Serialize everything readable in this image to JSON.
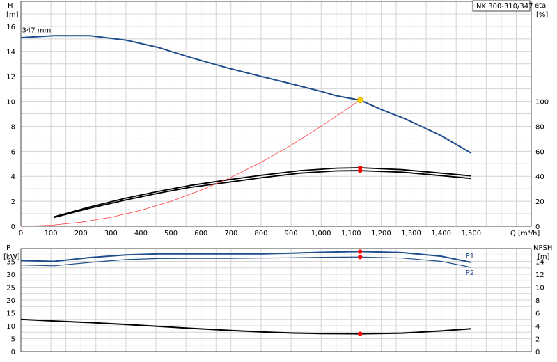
{
  "chart_data": [
    {
      "type": "line",
      "title": "NK 300-310/347",
      "ylabel_left": [
        "H",
        "[m]"
      ],
      "ylabel_right": [
        "eta",
        "[%]"
      ],
      "xlabel": "Q [m³/h]",
      "xlim": [
        0,
        1700
      ],
      "ylim_left": [
        0,
        18
      ],
      "ylim_right_range": [
        0,
        100
      ],
      "grid": true,
      "x_ticks": [
        0,
        100,
        200,
        300,
        400,
        500,
        600,
        700,
        800,
        900,
        1000,
        1100,
        1200,
        1300,
        1400,
        1500
      ],
      "x_tick_labels": [
        "0",
        "100",
        "200",
        "300",
        "400",
        "500",
        "600",
        "700",
        "800",
        "900",
        "1,000",
        "1,100",
        "1,200",
        "1,300",
        "1,400",
        "1,500"
      ],
      "y_left_ticks": [
        0,
        2,
        4,
        6,
        8,
        10,
        12,
        14,
        16
      ],
      "y_right_ticks": [
        0,
        20,
        40,
        60,
        80,
        100
      ],
      "annotations": [
        {
          "text": "347 mm",
          "x": 80,
          "y": 15.3
        }
      ],
      "series": [
        {
          "role": "head",
          "color": "#1f4e8c",
          "axis": "left",
          "x": [
            0,
            110,
            230,
            350,
            460,
            560,
            700,
            800,
            900,
            1000,
            1050,
            1130,
            1200,
            1280,
            1400,
            1500
          ],
          "y": [
            15.1,
            15.25,
            15.25,
            14.9,
            14.3,
            13.55,
            12.6,
            12.0,
            11.4,
            10.8,
            10.45,
            10.1,
            9.35,
            8.6,
            7.25,
            5.85
          ]
        },
        {
          "role": "efficiency-upper",
          "color": "#000000",
          "axis": "right",
          "x": [
            110,
            230,
            350,
            460,
            560,
            700,
            800,
            930,
            1050,
            1130,
            1270,
            1400,
            1500
          ],
          "y": [
            7.5,
            15.5,
            22.5,
            28.0,
            32.5,
            37.5,
            40.8,
            44.5,
            46.5,
            46.8,
            45.3,
            42.5,
            40.3
          ]
        },
        {
          "role": "efficiency-lower",
          "color": "#000000",
          "axis": "right",
          "x": [
            110,
            230,
            350,
            460,
            560,
            700,
            800,
            930,
            1050,
            1130,
            1270,
            1400,
            1500
          ],
          "y": [
            7.0,
            14.5,
            21.0,
            26.5,
            31.0,
            35.5,
            38.8,
            42.5,
            44.3,
            44.5,
            43.3,
            40.5,
            38.3
          ]
        },
        {
          "role": "system-curve",
          "color": "#ff3a3a",
          "axis": "left",
          "x": [
            0,
            100,
            200,
            300,
            400,
            500,
            600,
            700,
            800,
            900,
            1000,
            1130
          ],
          "y": [
            0,
            0.08,
            0.32,
            0.72,
            1.28,
            2.0,
            2.88,
            3.92,
            5.12,
            6.48,
            8.0,
            10.1
          ]
        }
      ],
      "operating_points": [
        {
          "series": "head",
          "x": 1130,
          "y": 10.1,
          "color": "#ffd000"
        },
        {
          "series": "efficiency-upper",
          "x": 1130,
          "y": 46.8,
          "color": "#ff0000"
        },
        {
          "series": "efficiency-lower",
          "x": 1130,
          "y": 44.5,
          "color": "#ff0000"
        }
      ]
    },
    {
      "type": "line",
      "ylabel_left": [
        "P",
        "[kW]"
      ],
      "ylabel_right": [
        "NPSH",
        "[m]"
      ],
      "xlim": [
        0,
        1700
      ],
      "ylim_left": [
        0,
        40
      ],
      "ylim_right": [
        0,
        16
      ],
      "grid": true,
      "y_left_ticks": [
        0,
        5,
        10,
        15,
        20,
        25,
        30,
        35
      ],
      "y_right_ticks": [
        0,
        2,
        4,
        6,
        8,
        10,
        12,
        14
      ],
      "series": [
        {
          "name": "P1",
          "color": "#1f4e8c",
          "axis": "left",
          "x": [
            0,
            110,
            230,
            350,
            460,
            560,
            700,
            800,
            900,
            1000,
            1130,
            1270,
            1400,
            1500
          ],
          "y": [
            35.3,
            35.0,
            36.5,
            37.5,
            37.9,
            37.9,
            37.9,
            37.9,
            38.2,
            38.5,
            38.8,
            38.4,
            37.0,
            34.6
          ]
        },
        {
          "name": "P2",
          "color": "#1f4e8c",
          "axis": "left",
          "x": [
            0,
            110,
            230,
            350,
            460,
            560,
            700,
            800,
            900,
            1000,
            1130,
            1270,
            1400,
            1500
          ],
          "y": [
            33.6,
            33.3,
            34.6,
            35.7,
            36.1,
            36.2,
            36.2,
            36.3,
            36.4,
            36.6,
            36.7,
            36.3,
            35.0,
            32.7
          ]
        },
        {
          "role": "npsh",
          "color": "#000000",
          "axis": "right",
          "x": [
            0,
            110,
            230,
            350,
            460,
            560,
            700,
            800,
            900,
            1000,
            1130,
            1270,
            1400,
            1500
          ],
          "y": [
            5.0,
            4.75,
            4.5,
            4.2,
            3.9,
            3.62,
            3.28,
            3.05,
            2.88,
            2.78,
            2.75,
            2.85,
            3.2,
            3.55
          ]
        }
      ],
      "operating_points": [
        {
          "series": "P1",
          "x": 1130,
          "y": 38.8,
          "color": "#ff0000"
        },
        {
          "series": "P2",
          "x": 1130,
          "y": 36.7,
          "color": "#ff0000"
        },
        {
          "series": "npsh",
          "x": 1130,
          "y": 2.75,
          "color": "#ff0000"
        }
      ]
    }
  ]
}
